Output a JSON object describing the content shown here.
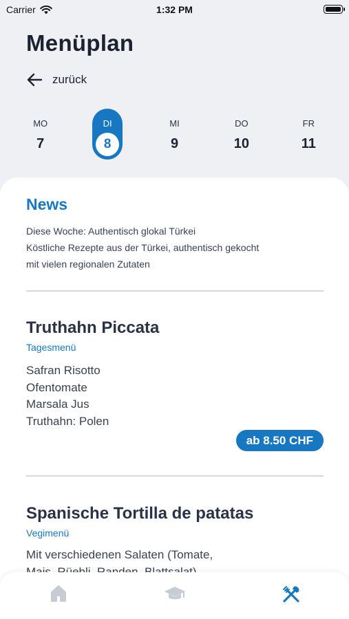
{
  "status_bar": {
    "carrier": "Carrier",
    "time": "1:32 PM"
  },
  "header": {
    "title": "Menüplan",
    "back_label": "zurück"
  },
  "days": [
    {
      "label": "MO",
      "num": "7",
      "active": false
    },
    {
      "label": "DI",
      "num": "8",
      "active": true
    },
    {
      "label": "MI",
      "num": "9",
      "active": false
    },
    {
      "label": "DO",
      "num": "10",
      "active": false
    },
    {
      "label": "FR",
      "num": "11",
      "active": false
    }
  ],
  "news": {
    "title": "News",
    "lines": [
      "Diese Woche: Authentisch glokal Türkei",
      "Köstliche Rezepte aus der Türkei, authentisch gekocht",
      "mit vielen regionalen Zutaten"
    ]
  },
  "meals": [
    {
      "title": "Truthahn Piccata",
      "type": "Tagesmenü",
      "items": [
        "Safran Risotto",
        "Ofentomate",
        "Marsala Jus",
        "Truthahn: Polen"
      ],
      "price": "ab 8.50 CHF"
    },
    {
      "title": "Spanische Tortilla de patatas",
      "type": "Vegimenü",
      "items": [
        "Mit verschiedenen Salaten (Tomate,",
        "Mais, Rüebli, Randen, Blattsalat)"
      ]
    }
  ],
  "tabbar": {
    "tabs": [
      {
        "icon": "home-icon",
        "active": false
      },
      {
        "icon": "graduation-cap-icon",
        "active": false
      },
      {
        "icon": "utensils-icon",
        "active": true
      }
    ]
  },
  "colors": {
    "accent": "#1778c1",
    "background": "#eef0f4",
    "inactive_icon": "#c7cbd3"
  }
}
